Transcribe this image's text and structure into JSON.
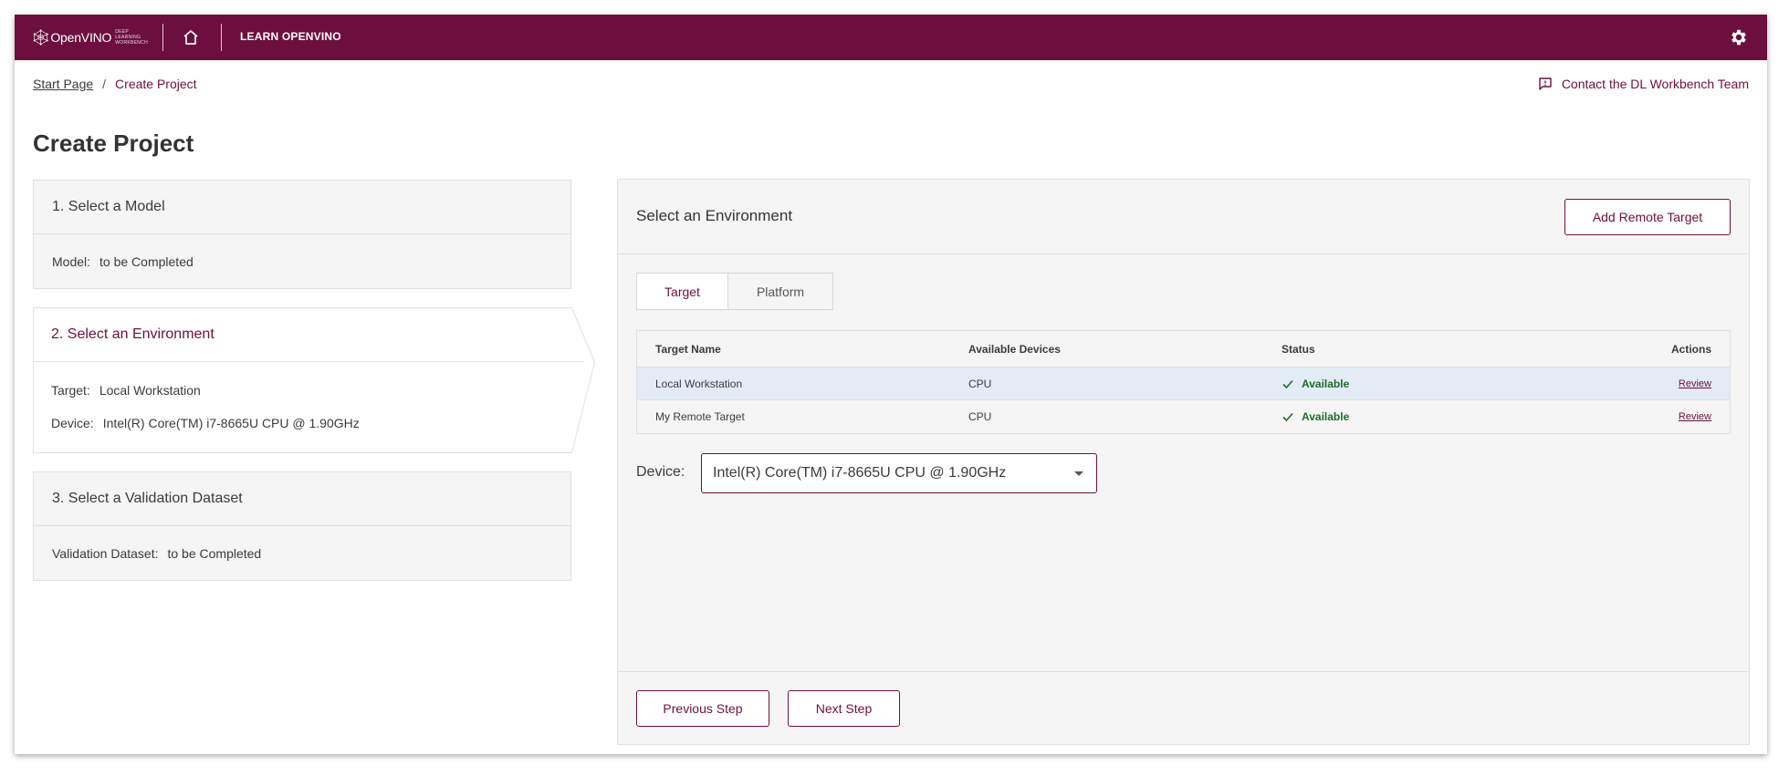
{
  "header": {
    "logo_text": "OpenVINO",
    "logo_subtitle": "DEEP LEARNING WORKBENCH",
    "learn_link": "LEARN OPENVINO",
    "home_icon": "home-icon",
    "settings_icon": "gear-icon"
  },
  "breadcrumb": {
    "items": [
      "Start Page",
      "Create Project"
    ],
    "separator": "/"
  },
  "contact": {
    "label": "Contact the DL Workbench Team",
    "icon": "feedback-icon"
  },
  "page_title": "Create Project",
  "steps": [
    {
      "title": "1. Select a Model",
      "rows": [
        {
          "label": "Model:",
          "value": "to be Completed"
        }
      ]
    },
    {
      "title": "2. Select an Environment",
      "active": true,
      "rows": [
        {
          "label": "Target:",
          "value": "Local Workstation"
        },
        {
          "label": "Device:",
          "value": "Intel(R) Core(TM) i7-8665U CPU @ 1.90GHz"
        }
      ]
    },
    {
      "title": "3. Select a Validation Dataset",
      "rows": [
        {
          "label": "Validation Dataset:",
          "value": "to be Completed"
        }
      ]
    }
  ],
  "environment": {
    "title": "Select an Environment",
    "add_remote_button": "Add Remote Target",
    "tabs": [
      "Target",
      "Platform"
    ],
    "active_tab": "Target",
    "table": {
      "columns": [
        "Target Name",
        "Available Devices",
        "Status",
        "Actions"
      ],
      "rows": [
        {
          "name": "Local Workstation",
          "devices": "CPU",
          "status": "Available",
          "action": "Review",
          "selected": true
        },
        {
          "name": "My Remote Target",
          "devices": "CPU",
          "status": "Available",
          "action": "Review",
          "selected": false
        }
      ]
    },
    "device_label": "Device:",
    "device_value": "Intel(R) Core(TM) i7-8665U CPU @ 1.90GHz",
    "previous_button": "Previous Step",
    "next_button": "Next Step"
  },
  "colors": {
    "brand": "#6d0f3e",
    "panel_bg": "#f5f5f5",
    "selected_row": "#e3ecf5",
    "status_ok": "#1e6b2a"
  }
}
